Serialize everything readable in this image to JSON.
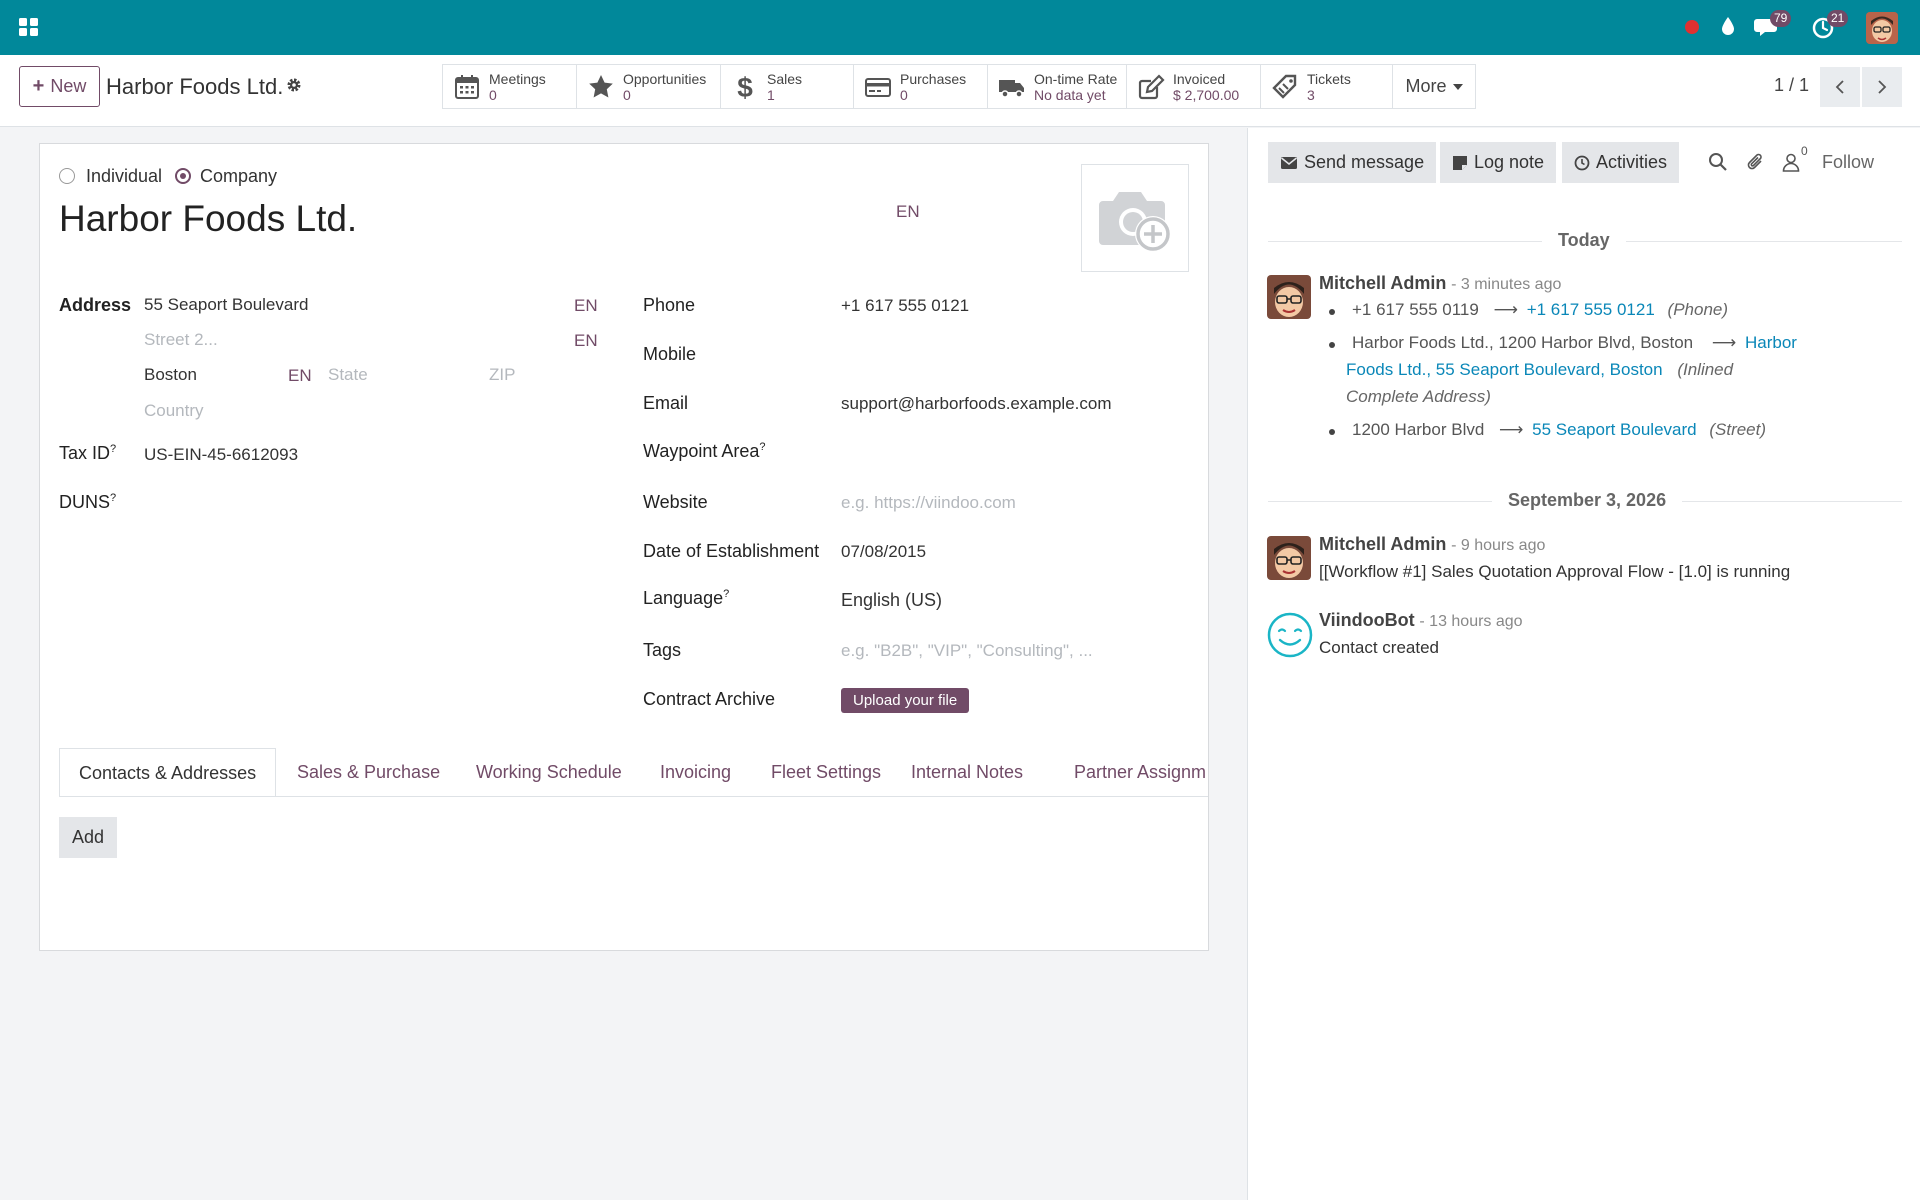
{
  "navbar": {
    "messages_count": "79",
    "activities_count": "21",
    "colors": {
      "bar": "#01889a",
      "badge": "#714b67",
      "status_dot": "#e03131"
    }
  },
  "control_panel": {
    "new_label": "New",
    "breadcrumb_title": "Harbor Foods Ltd.",
    "smart_buttons": [
      {
        "icon": "calendar-icon",
        "label": "Meetings",
        "value": "0"
      },
      {
        "icon": "star-icon",
        "label": "Opportunities",
        "value": "0"
      },
      {
        "icon": "dollar-icon",
        "label": "Sales",
        "value": "1"
      },
      {
        "icon": "credit-card-icon",
        "label": "Purchases",
        "value": "0"
      },
      {
        "icon": "truck-icon",
        "label": "On-time Rate",
        "value": "No data yet"
      },
      {
        "icon": "pencil-square-icon",
        "label": "Invoiced",
        "value": "$ 2,700.00"
      },
      {
        "icon": "ticket-icon",
        "label": "Tickets",
        "value": "3"
      }
    ],
    "more_label": "More",
    "pager": "1 / 1"
  },
  "form": {
    "company_type": {
      "individual": "Individual",
      "company": "Company",
      "selected": "company"
    },
    "name": "Harbor Foods Ltd.",
    "lang_tag": "EN",
    "address": {
      "label": "Address",
      "street": "55 Seaport Boulevard",
      "street2_placeholder": "Street 2...",
      "city": "Boston",
      "state_placeholder": "State",
      "zip_placeholder": "ZIP",
      "country_placeholder": "Country"
    },
    "tax_id": {
      "label": "Tax ID",
      "value": "US-EIN-45-6612093"
    },
    "duns": {
      "label": "DUNS"
    },
    "help_mark": "?",
    "phone": {
      "label": "Phone",
      "value": "+1 617 555 0121"
    },
    "mobile": {
      "label": "Mobile"
    },
    "email": {
      "label": "Email",
      "value": "support@harborfoods.example.com"
    },
    "waypoint_area": {
      "label": "Waypoint Area"
    },
    "website": {
      "label": "Website",
      "placeholder": "e.g. https://viindoo.com"
    },
    "date_establishment": {
      "label": "Date of Establishment",
      "value": "07/08/2015"
    },
    "language": {
      "label": "Language",
      "value": "English (US)"
    },
    "tags": {
      "label": "Tags",
      "placeholder": "e.g. \"B2B\", \"VIP\", \"Consulting\", ..."
    },
    "contract_archive": {
      "label": "Contract Archive",
      "button": "Upload your file"
    },
    "tabs": [
      "Contacts & Addresses",
      "Sales & Purchase",
      "Working Schedule",
      "Invoicing",
      "Fleet Settings",
      "Internal Notes",
      "Partner Assignm"
    ],
    "add_label": "Add"
  },
  "chatter": {
    "send_message": "Send message",
    "log_note": "Log note",
    "activities": "Activities",
    "followers_count": "0",
    "follow": "Follow",
    "groups": [
      {
        "date": "Today",
        "messages": [
          {
            "author": "Mitchell Admin",
            "ago": "- 3 minutes ago",
            "tracking": [
              {
                "old": "+1 617 555 0119",
                "new": "+1 617 555 0121",
                "field": "(Phone)"
              },
              {
                "old": "Harbor Foods Ltd., 1200 Harbor Blvd, Boston",
                "new_a": "Harbor",
                "new_b": "Foods Ltd., 55 Seaport Boulevard, Boston",
                "field_a": "(Inlined",
                "field_b": "Complete Address)"
              },
              {
                "old": "1200 Harbor Blvd",
                "new": "55 Seaport Boulevard",
                "field": "(Street)"
              }
            ]
          }
        ]
      },
      {
        "date": "September 3, 2026",
        "messages": [
          {
            "author": "Mitchell Admin",
            "ago": "- 9 hours ago",
            "body": "[[Workflow #1] Sales Quotation Approval Flow - [1.0] is running"
          },
          {
            "author": "ViindooBot",
            "ago": "- 13 hours ago",
            "body": "Contact created"
          }
        ]
      }
    ],
    "colors": {
      "link": "#0a87b8",
      "bot": "#1ab5c6"
    }
  }
}
